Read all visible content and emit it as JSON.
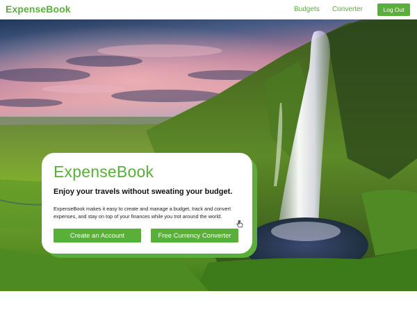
{
  "header": {
    "brand": "ExpenseBook",
    "nav": {
      "budgets": "Budgets",
      "converter": "Converter"
    },
    "logout_label": "Log Out"
  },
  "hero": {
    "image": "waterfall-landscape-photo",
    "card": {
      "title": "ExpenseBook",
      "tagline": "Enjoy your travels without sweating your budget.",
      "description": "ExpenseBook makes it easy to create and manage a budget, track and convert expenses, and stay on top of your finances while you trot around the world.",
      "create_account_label": "Create an Account",
      "converter_label": "Free Currency Converter"
    }
  },
  "colors": {
    "brand_green": "#5aae3a",
    "background": "#ffffff"
  }
}
